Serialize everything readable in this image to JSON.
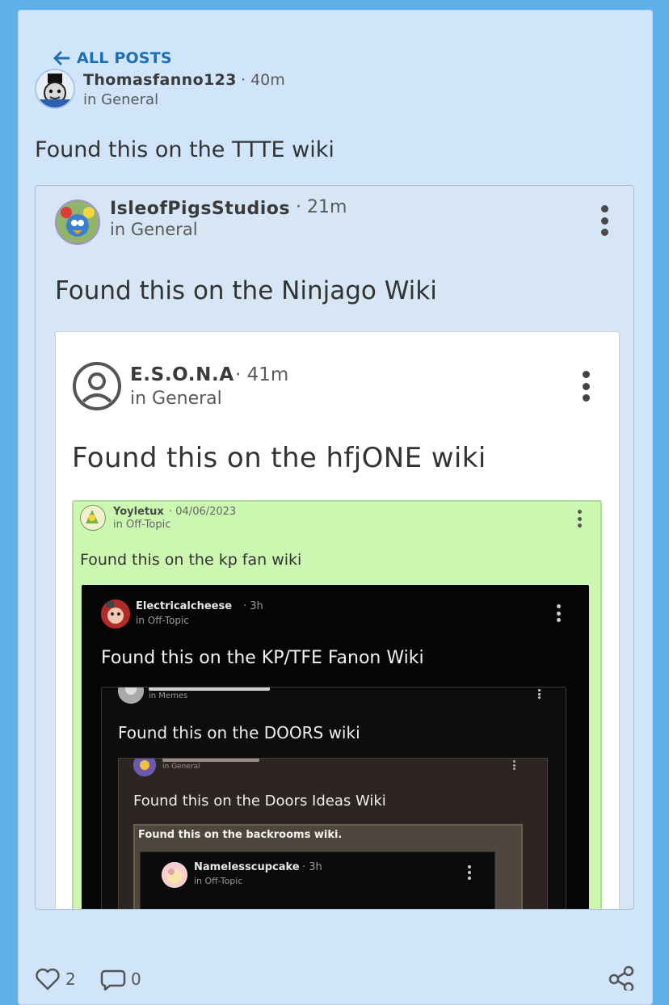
{
  "nav": {
    "back_label": "ALL POSTS"
  },
  "post": {
    "author": "Thomasfanno123",
    "time": "40m",
    "category": "in General",
    "title": "Found this on the TTTE wiki"
  },
  "embed1": {
    "author": "IsleofPigsStudios",
    "time": "21m",
    "category": "in General",
    "title": "Found this on the Ninjago Wiki"
  },
  "embed2": {
    "author": "E.S.O.N.A",
    "time": "41m",
    "category": "in General",
    "title": "Found this on the hfjONE wiki"
  },
  "embed3": {
    "author": "Yoyletux",
    "time": "04/06/2023",
    "category": "in Off-Topic",
    "title": "Found this on the kp fan wiki"
  },
  "embed4": {
    "author": "Electricalcheese",
    "time": "3h",
    "category": "in Off-Topic",
    "title": "Found this on the KP/TFE Fanon Wiki"
  },
  "embed5": {
    "category": "in Memes",
    "title": "Found this on the DOORS wiki"
  },
  "embed6": {
    "category": "in General",
    "title": "Found this on the Doors Ideas Wiki"
  },
  "embed7": {
    "title": "Found this on the backrooms wiki."
  },
  "embed8": {
    "author": "Namelesscupcake",
    "time": "3h",
    "category": "in Off-Topic"
  },
  "footer": {
    "likes": "2",
    "comments": "0"
  },
  "icons": {
    "back": "arrow-left-icon",
    "more": "more-vertical-icon",
    "like": "heart-icon",
    "comment": "comment-icon",
    "share": "share-icon"
  },
  "colors": {
    "page_bg": "#5fb0e8",
    "card_bg": "#d0e5f9",
    "accent": "#1d6fb8",
    "embed3_bg": "#ccf7b0"
  }
}
